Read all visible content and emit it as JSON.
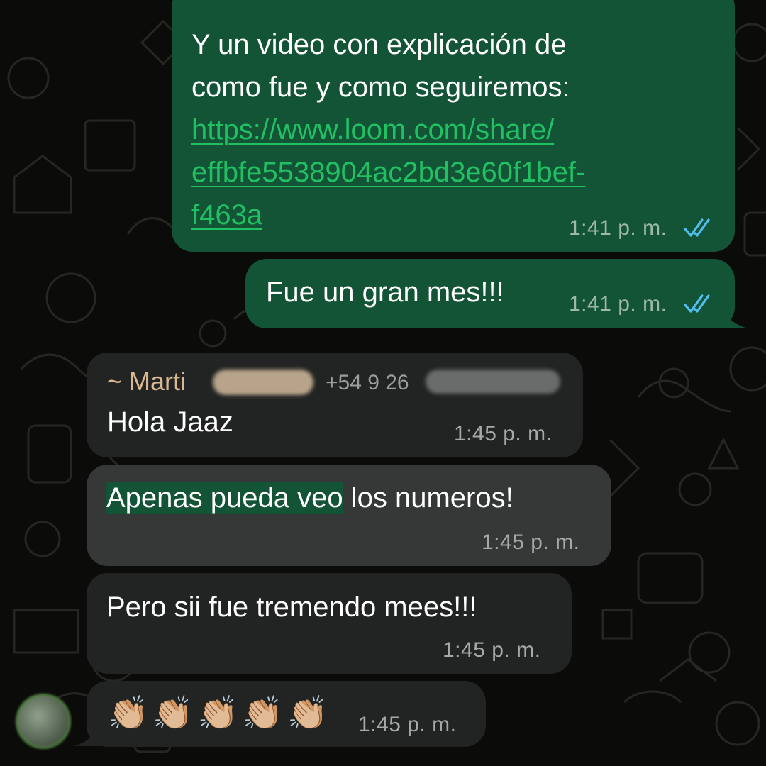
{
  "chat": {
    "messages": [
      {
        "direction": "outgoing",
        "lines": [
          "Y un video con explicación de",
          "como fue y como seguiremos:"
        ],
        "link_lines": [
          "https://www.loom.com/share/",
          "effbfe5538904ac2bd3e60f1bef-",
          "f463a"
        ],
        "time": "1:41 p. m.",
        "status": "read"
      },
      {
        "direction": "outgoing",
        "text": "Fue un gran mes!!!",
        "time": "1:41 p. m.",
        "status": "read"
      },
      {
        "direction": "incoming",
        "sender_name": "~ Marti",
        "sender_phone": "+54 9 26",
        "text": "Hola Jaaz",
        "time": "1:45 p. m."
      },
      {
        "direction": "incoming",
        "selected": true,
        "highlight": "Apenas pueda veo",
        "text_rest": " los numeros!",
        "time": "1:45 p. m."
      },
      {
        "direction": "incoming",
        "text": "Pero sii fue tremendo mees!!!",
        "time": "1:45 p. m."
      },
      {
        "direction": "incoming",
        "emoji": "👏🏼👏🏼👏🏼👏🏼👏🏼",
        "time": "1:45 p. m."
      }
    ]
  },
  "colors": {
    "background": "#0b0b0a",
    "outgoing_bubble": "#135336",
    "incoming_bubble": "#222423",
    "selected_bubble": "#363838",
    "link": "#21c063",
    "read_ticks": "#53bdeb",
    "sender_name": "#d9b892"
  },
  "icons": [
    "double-check-read-icon",
    "avatar-icon"
  ]
}
